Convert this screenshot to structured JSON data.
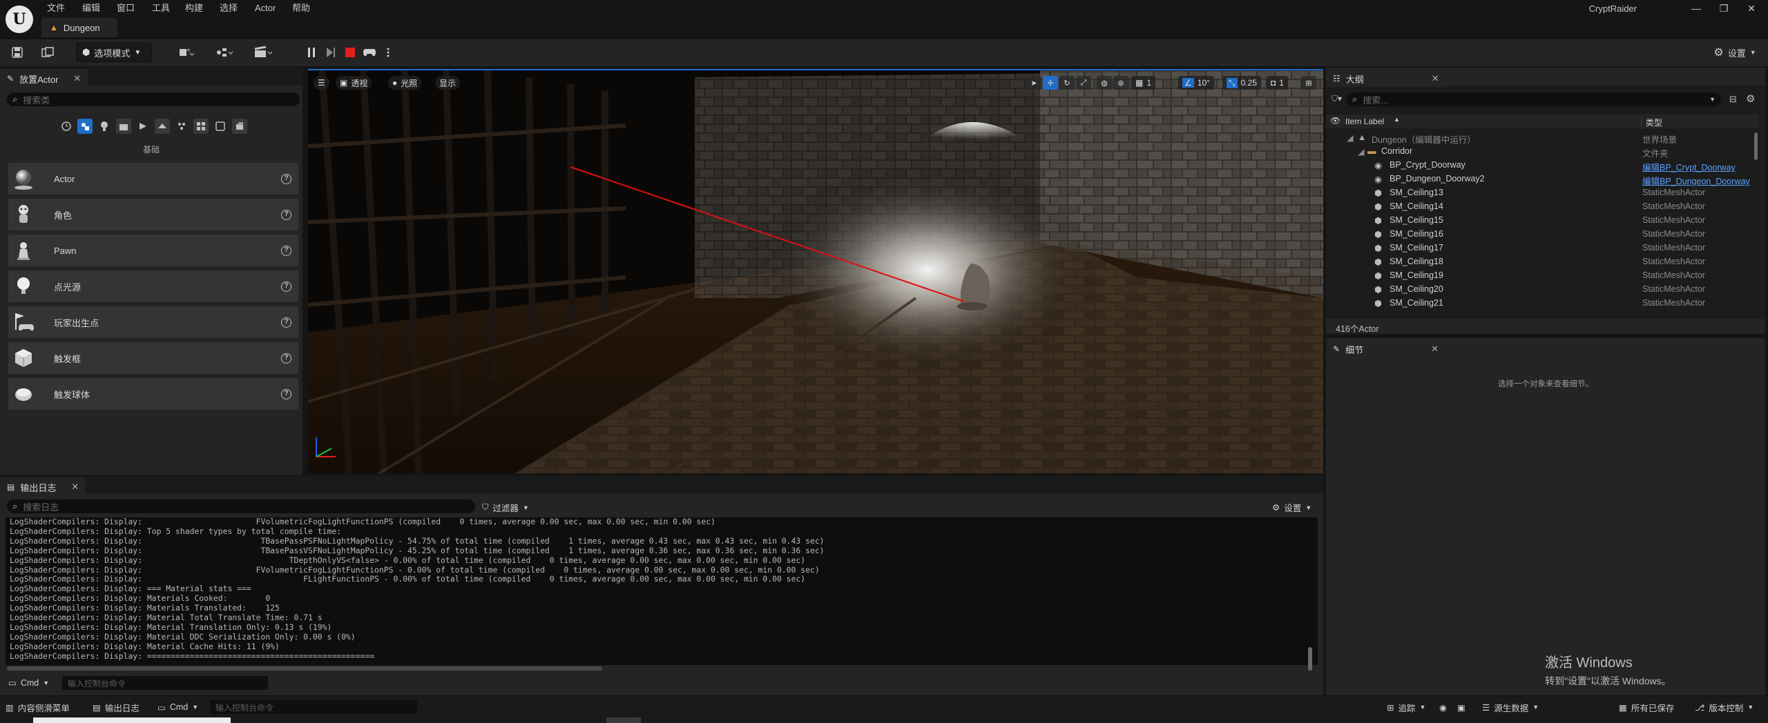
{
  "titlebar": {
    "menu": [
      "文件",
      "编辑",
      "窗口",
      "工具",
      "构建",
      "选择",
      "Actor",
      "帮助"
    ],
    "document_tab": "Dungeon",
    "project_name": "CryptRaider"
  },
  "toolbar": {
    "mode_label": "选项模式",
    "settings_label": "设置"
  },
  "place_actor": {
    "tab_label": "放置Actor",
    "search_placeholder": "搜索类",
    "section_label": "基础",
    "items": [
      {
        "label": "Actor",
        "icon": "sphere-icon"
      },
      {
        "label": "角色",
        "icon": "character-icon"
      },
      {
        "label": "Pawn",
        "icon": "pawn-icon"
      },
      {
        "label": "点光源",
        "icon": "light-bulb-icon"
      },
      {
        "label": "玩家出生点",
        "icon": "player-start-icon"
      },
      {
        "label": "触发框",
        "icon": "trigger-box-icon"
      },
      {
        "label": "触发球体",
        "icon": "trigger-sphere-icon"
      }
    ]
  },
  "viewport": {
    "perspective_label": "透视",
    "lighting_label": "光照",
    "show_label": "显示",
    "grid_value": "1",
    "rotation_snap": "10°",
    "scale_snap": "0.25",
    "camera_speed": "1"
  },
  "outliner": {
    "tab_label": "大纲",
    "search_placeholder": "搜索...",
    "col_label": "Item Label",
    "col_type": "类型",
    "rows": [
      {
        "name": "Dungeon（编辑器中运行）",
        "type": "世界场景",
        "indent": 1,
        "kind": "world"
      },
      {
        "name": "Corridor",
        "type": "文件夹",
        "indent": 2,
        "kind": "folder"
      },
      {
        "name": "BP_Crypt_Doorway",
        "type": "编辑BP_Crypt_Doorway",
        "indent": 3,
        "kind": "bp",
        "link": true
      },
      {
        "name": "BP_Dungeon_Doorway2",
        "type": "编辑BP_Dungeon_Doorway",
        "indent": 3,
        "kind": "bp",
        "link": true
      },
      {
        "name": "SM_Ceiling13",
        "type": "StaticMeshActor",
        "indent": 3,
        "kind": "mesh"
      },
      {
        "name": "SM_Ceiling14",
        "type": "StaticMeshActor",
        "indent": 3,
        "kind": "mesh"
      },
      {
        "name": "SM_Ceiling15",
        "type": "StaticMeshActor",
        "indent": 3,
        "kind": "mesh"
      },
      {
        "name": "SM_Ceiling16",
        "type": "StaticMeshActor",
        "indent": 3,
        "kind": "mesh"
      },
      {
        "name": "SM_Ceiling17",
        "type": "StaticMeshActor",
        "indent": 3,
        "kind": "mesh"
      },
      {
        "name": "SM_Ceiling18",
        "type": "StaticMeshActor",
        "indent": 3,
        "kind": "mesh"
      },
      {
        "name": "SM_Ceiling19",
        "type": "StaticMeshActor",
        "indent": 3,
        "kind": "mesh"
      },
      {
        "name": "SM_Ceiling20",
        "type": "StaticMeshActor",
        "indent": 3,
        "kind": "mesh"
      },
      {
        "name": "SM_Ceiling21",
        "type": "StaticMeshActor",
        "indent": 3,
        "kind": "mesh"
      }
    ],
    "actor_count": "416个Actor"
  },
  "details": {
    "tab_label": "细节",
    "hint": "选择一个对象来查看细节。"
  },
  "output_log": {
    "tab_label": "输出日志",
    "search_placeholder": "搜索日志",
    "filter_label": "过滤器",
    "settings_label": "设置",
    "lines": [
      "LogShaderCompilers: Display:                        FVolumetricFogLightFunctionPS (compiled    0 times, average 0.00 sec, max 0.00 sec, min 0.00 sec)",
      "LogShaderCompilers: Display: Top 5 shader types by total compile time:",
      "LogShaderCompilers: Display:                         TBasePassPSFNoLightMapPolicy - 54.75% of total time (compiled    1 times, average 0.43 sec, max 0.43 sec, min 0.43 sec)",
      "LogShaderCompilers: Display:                         TBasePassVSFNoLightMapPolicy - 45.25% of total time (compiled    1 times, average 0.36 sec, max 0.36 sec, min 0.36 sec)",
      "LogShaderCompilers: Display:                               TDepthOnlyVS<false> - 0.00% of total time (compiled    0 times, average 0.00 sec, max 0.00 sec, min 0.00 sec)",
      "LogShaderCompilers: Display:                        FVolumetricFogLightFunctionPS - 0.00% of total time (compiled    0 times, average 0.00 sec, max 0.00 sec, min 0.00 sec)",
      "LogShaderCompilers: Display:                                  FLightFunctionPS - 0.00% of total time (compiled    0 times, average 0.00 sec, max 0.00 sec, min 0.00 sec)",
      "LogShaderCompilers: Display: === Material stats ===",
      "LogShaderCompilers: Display: Materials Cooked:        0",
      "LogShaderCompilers: Display: Materials Translated:    125",
      "LogShaderCompilers: Display: Material Total Translate Time: 0.71 s",
      "LogShaderCompilers: Display: Material Translation Only: 0.13 s (19%)",
      "LogShaderCompilers: Display: Material DDC Serialization Only: 0.00 s (0%)",
      "LogShaderCompilers: Display: Material Cache Hits: 11 (9%)",
      "LogShaderCompilers: Display: ================================================"
    ],
    "cmd_label": "Cmd",
    "cmd_placeholder": "输入控制台命令"
  },
  "statusbar": {
    "content_drawer": "内容侧滑菜单",
    "output_log": "输出日志",
    "cmd_label": "Cmd",
    "cmd_placeholder": "输入控制台命令",
    "trace": "追踪",
    "source_data": "源生数据",
    "all_saved": "所有已保存",
    "revision_control": "版本控制"
  },
  "watermark": {
    "line1": "激活 Windows",
    "line2": "转到\"设置\"以激活 Windows。"
  },
  "colors": {
    "accent": "#1f6ec7",
    "panel": "#242424",
    "background": "#151515",
    "link": "#5aa0ff",
    "stop_red": "#e02020"
  }
}
